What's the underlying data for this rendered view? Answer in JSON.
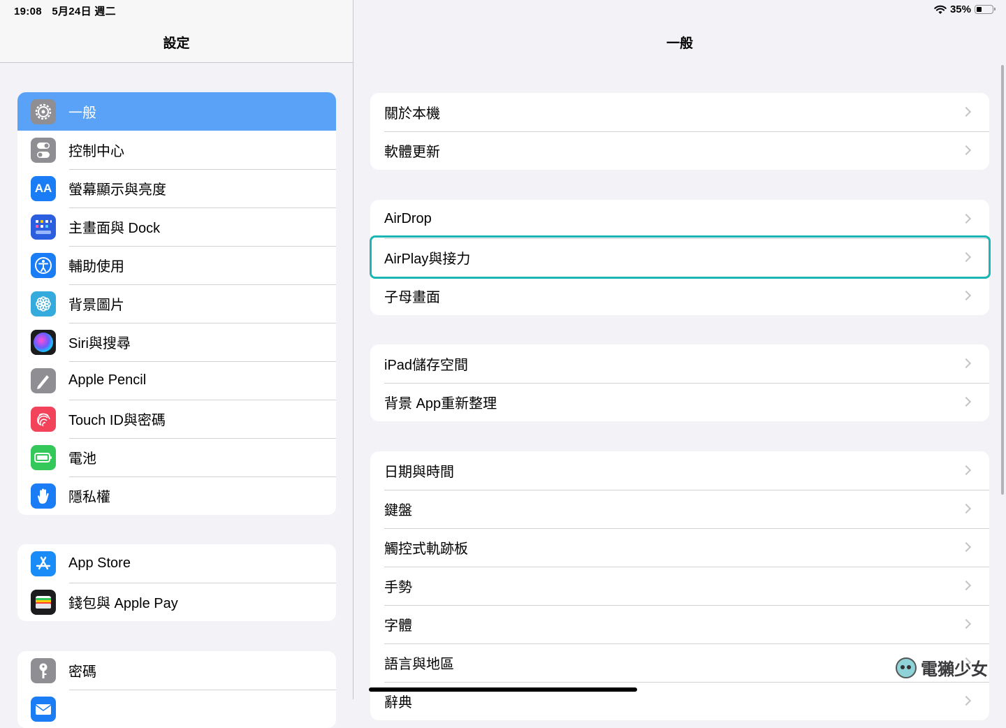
{
  "status_bar": {
    "time": "19:08",
    "date": "5月24日 週二",
    "battery_percent": "35%",
    "battery_level": 0.35
  },
  "sidebar": {
    "title": "設定",
    "groups": [
      [
        {
          "label": "一般",
          "icon": "gear-icon",
          "color": "#8e8e93",
          "selected": true
        },
        {
          "label": "控制中心",
          "icon": "toggles-icon",
          "color": "#8e8e93"
        },
        {
          "label": "螢幕顯示與亮度",
          "icon": "text-size-icon",
          "color": "#1a7df5"
        },
        {
          "label": "主畫面與 Dock",
          "icon": "home-screen-grid-icon",
          "color": "#2c5fe0"
        },
        {
          "label": "輔助使用",
          "icon": "accessibility-icon",
          "color": "#1a7df5"
        },
        {
          "label": "背景圖片",
          "icon": "flower-icon",
          "color": "#35aadc"
        },
        {
          "label": "Siri與搜尋",
          "icon": "siri-icon",
          "color": "#1c1c1e"
        },
        {
          "label": "Apple Pencil",
          "icon": "pencil-icon",
          "color": "#8e8e93"
        },
        {
          "label": "Touch ID與密碼",
          "icon": "fingerprint-icon",
          "color": "#f2435a"
        },
        {
          "label": "電池",
          "icon": "battery-icon",
          "color": "#34c759"
        },
        {
          "label": "隱私權",
          "icon": "hand-icon",
          "color": "#1a7df5"
        }
      ],
      [
        {
          "label": "App Store",
          "icon": "app-store-icon",
          "color": "#1a8cf7"
        },
        {
          "label": "錢包與 Apple Pay",
          "icon": "wallet-icon",
          "color": "#1c1c1e"
        }
      ],
      [
        {
          "label": "密碼",
          "icon": "key-icon",
          "color": "#8e8e93"
        },
        {
          "label": "",
          "icon": "mail-icon",
          "color": "#1a7df5"
        }
      ]
    ]
  },
  "main": {
    "title": "一般",
    "groups": [
      [
        "關於本機",
        "軟體更新"
      ],
      [
        "AirDrop",
        "AirPlay與接力",
        "子母畫面"
      ],
      [
        "iPad儲存空間",
        "背景 App重新整理"
      ],
      [
        "日期與時間",
        "鍵盤",
        "觸控式軌跡板",
        "手勢",
        "字體",
        "語言與地區",
        "辭典"
      ]
    ],
    "highlighted": "AirPlay與接力"
  },
  "watermark": {
    "text": "電獺少女"
  },
  "colors": {
    "selected": "#5aa2f7",
    "highlight_border": "#1cb5b5",
    "background": "#f2f2f7"
  }
}
